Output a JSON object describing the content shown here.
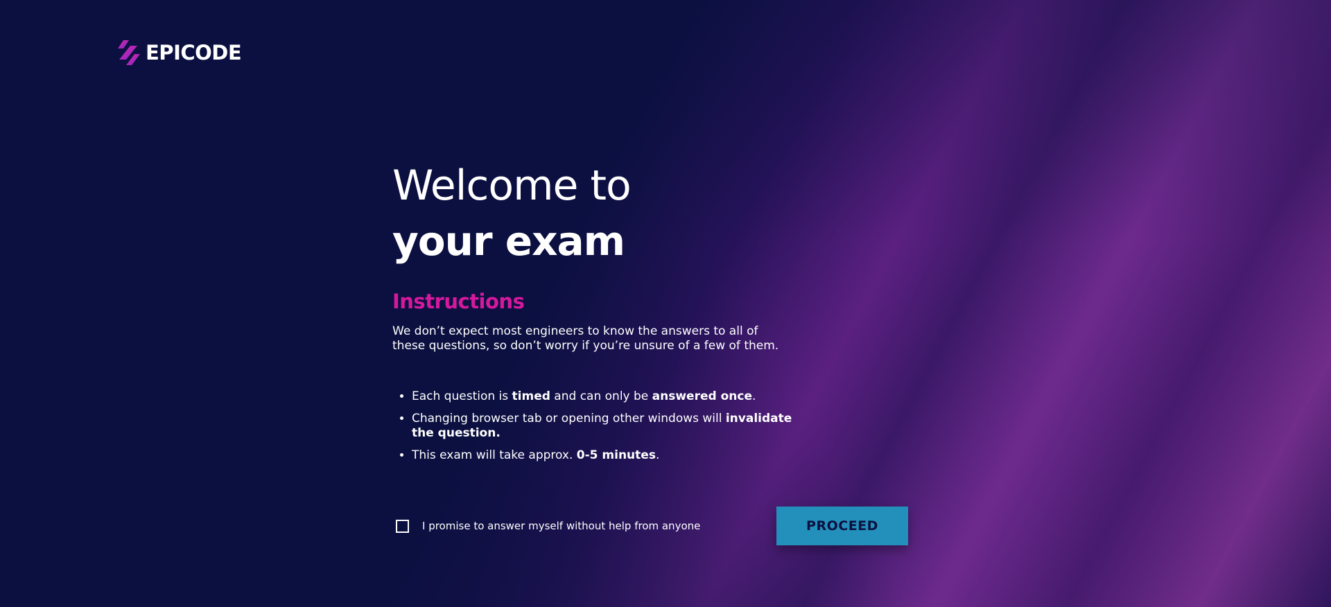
{
  "brand": {
    "name": "EPICODE",
    "accent_color": "#d5199e",
    "background_color": "#0b1040"
  },
  "hero": {
    "title_line1": "Welcome to",
    "title_line2": "your exam"
  },
  "instructions": {
    "heading": "Instructions",
    "intro": "We don’t expect most engineers to know the answers to all of these questions, so don’t worry if you’re unsure of a few of them.",
    "rules": [
      {
        "parts": [
          {
            "text": "Each question is ",
            "bold": false
          },
          {
            "text": "timed",
            "bold": true
          },
          {
            "text": " and can only be ",
            "bold": false
          },
          {
            "text": "answered once",
            "bold": true
          },
          {
            "text": ".",
            "bold": false
          }
        ]
      },
      {
        "parts": [
          {
            "text": "Changing browser tab or opening other windows will ",
            "bold": false
          },
          {
            "text": "invalidate the question",
            "bold": true
          },
          {
            "text": ".",
            "bold": false
          }
        ]
      },
      {
        "parts": [
          {
            "text": "This exam will take approx. ",
            "bold": false
          },
          {
            "text": "0-5 minutes",
            "bold": true
          },
          {
            "text": ".",
            "bold": false
          }
        ]
      }
    ]
  },
  "promise": {
    "label": "I promise to answer myself without help from anyone",
    "checked": false
  },
  "proceed_button": {
    "label": "PROCEED",
    "color": "#2390bb"
  }
}
